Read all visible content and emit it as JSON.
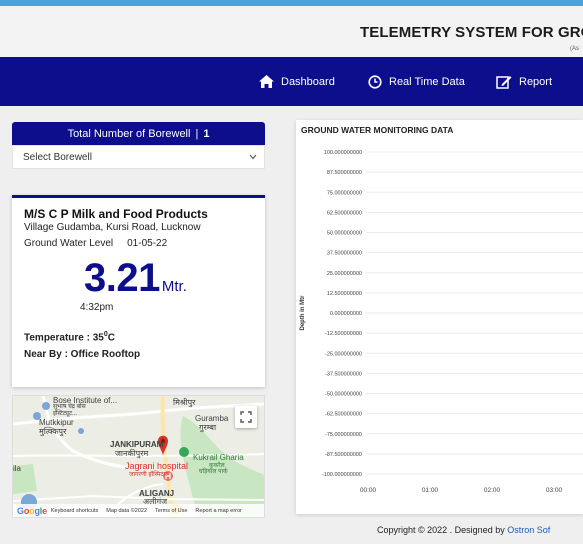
{
  "header": {
    "title": "TELEMETRY SYSTEM FOR GRO",
    "subtitle": "(As"
  },
  "nav": {
    "items": [
      {
        "label": "Dashboard",
        "icon": "home-icon"
      },
      {
        "label": "Real Time Data",
        "icon": "clock-icon"
      },
      {
        "label": "Report",
        "icon": "edit-icon"
      }
    ]
  },
  "sidebar": {
    "total_label": "Total Number of Borewell",
    "total_value": "1",
    "select_placeholder": "Select Borewell"
  },
  "borewell_card": {
    "company": "M/S C P Milk and Food Products",
    "address": "Village Gudamba, Kursi Road, Lucknow",
    "level_label": "Ground Water Level",
    "date": "01-05-22",
    "reading": "3.21",
    "unit": "Mtr.",
    "time": "4:32pm",
    "temperature_label": "Temperature : 35",
    "temperature_unit": "C",
    "near_by": "Near By : Office Rooftop"
  },
  "map": {
    "labels": [
      {
        "text": "Bose Institute of...",
        "style": ""
      },
      {
        "text": "सुभाष चंद्र बोस",
        "style": ""
      },
      {
        "text": "इंस्टिट्यूट...",
        "style": ""
      },
      {
        "text": "मिश्रीपुर",
        "style": ""
      },
      {
        "text": "Mutkkipur",
        "style": ""
      },
      {
        "text": "मुत्क्किपुर",
        "style": ""
      },
      {
        "text": "Guramba",
        "style": ""
      },
      {
        "text": "गुरम्बा",
        "style": ""
      },
      {
        "text": "JANKIPURAM",
        "style": "bold"
      },
      {
        "text": "जानकीपुरम",
        "style": ""
      },
      {
        "text": "Jagrani hospital",
        "style": "red"
      },
      {
        "text": "जागरणी हॉस्पिटल",
        "style": "red"
      },
      {
        "text": "Kukrail Gharia",
        "style": "green"
      },
      {
        "text": "कुकरैल",
        "style": "green"
      },
      {
        "text": "घड़ियाल पार्क",
        "style": "green"
      },
      {
        "text": "ALIGANJ",
        "style": "bold"
      },
      {
        "text": "अलीगंज",
        "style": ""
      },
      {
        "text": "ila",
        "style": ""
      }
    ],
    "footer": [
      "Keyboard shortcuts",
      "Map data ©2022",
      "Terms of Use",
      "Report a map error"
    ],
    "logo": "Google"
  },
  "chart": {
    "title": "GROUND WATER MONITORING DATA",
    "ylabel": "Depth in Mtr"
  },
  "chart_data": {
    "type": "line",
    "title": "GROUND WATER MONITORING DATA",
    "ylabel": "Depth in Mtr",
    "xlabel": "",
    "x_ticks": [
      "00:00",
      "01:00",
      "02:00",
      "03:00"
    ],
    "y_ticks": [
      "100.000000000",
      "87.500000000",
      "75.000000000",
      "62.500000000",
      "50.000000000",
      "37.500000000",
      "25.000000000",
      "12.500000000",
      "0.000000000",
      "-12.500000000",
      "-25.000000000",
      "-37.500000000",
      "-50.000000000",
      "-62.500000000",
      "-75.000000000",
      "-87.500000000",
      "-100.000000000"
    ],
    "ylim": [
      -100,
      100
    ],
    "grid": true,
    "series": []
  },
  "footer": {
    "text": "Copyright © 2022 . Designed by ",
    "link": "Ostron Sof"
  }
}
